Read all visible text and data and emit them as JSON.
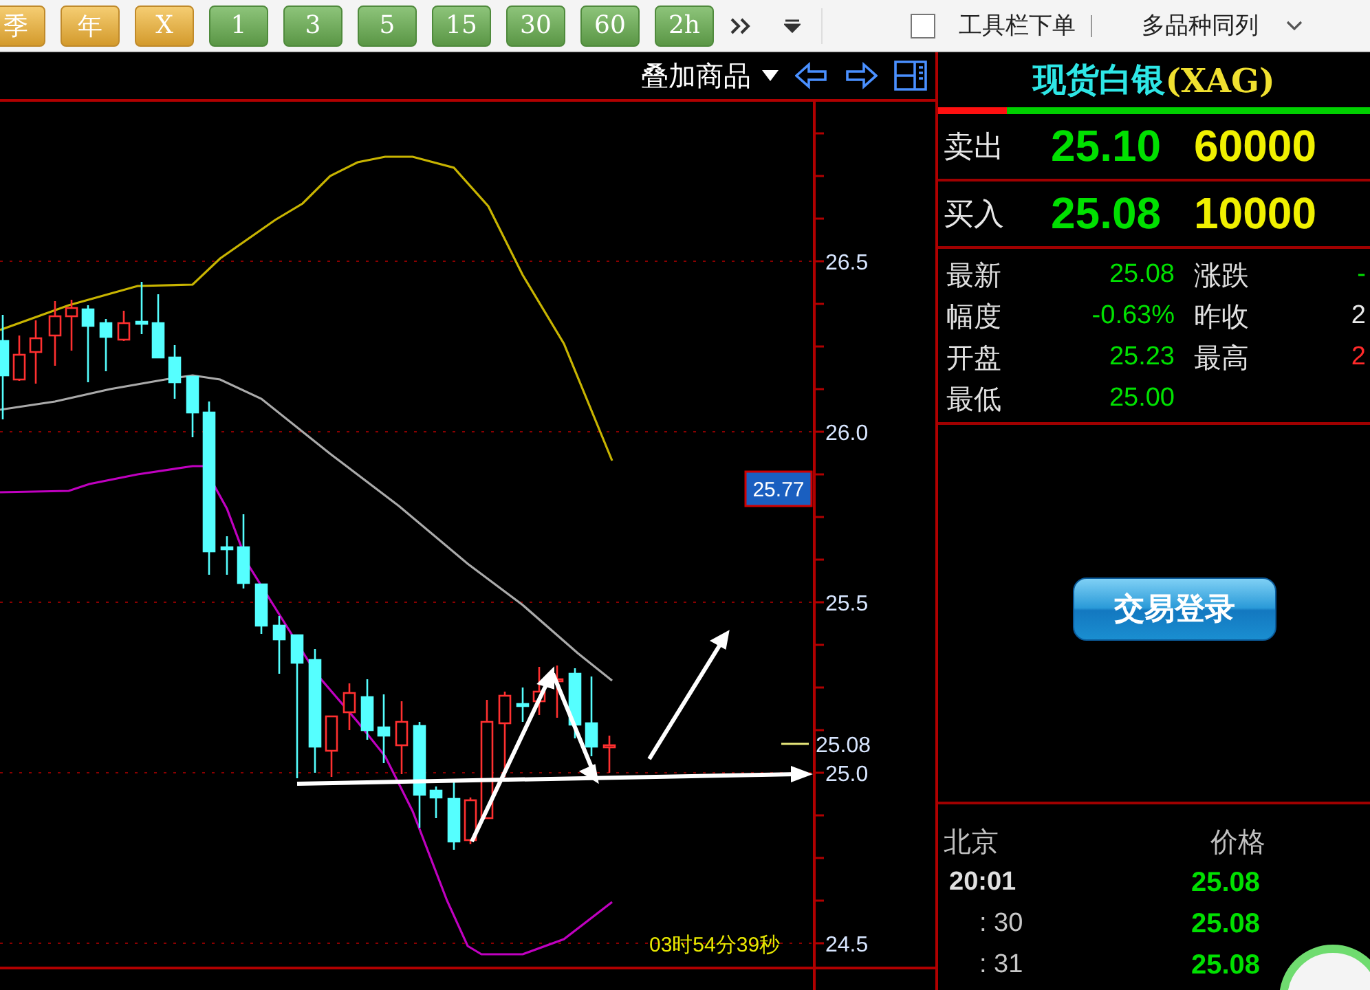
{
  "toolbar": {
    "periods": [
      {
        "label": "季",
        "kind": "long"
      },
      {
        "label": "年",
        "kind": "long"
      },
      {
        "label": "X",
        "kind": "long"
      },
      {
        "label": "1",
        "kind": "short"
      },
      {
        "label": "3",
        "kind": "short"
      },
      {
        "label": "5",
        "kind": "short"
      },
      {
        "label": "15",
        "kind": "short"
      },
      {
        "label": "30",
        "kind": "short"
      },
      {
        "label": "60",
        "kind": "short"
      },
      {
        "label": "2h",
        "kind": "short"
      }
    ],
    "toolbar_order": {
      "label": "工具栏下单",
      "checked": false
    },
    "layout_menu": {
      "label": "多品种同列"
    }
  },
  "chart": {
    "overlay_menu": "叠加商品",
    "price_axis": [
      "26.5",
      "26.0",
      "25.5",
      "25.0",
      "24.5"
    ],
    "last_price": "25.08",
    "cursor_price": "25.77",
    "countdown": "03时54分39秒"
  },
  "quote": {
    "title": "现货白银",
    "symbol": "(XAG)",
    "buy_sell_ratio": {
      "level": 0.16
    },
    "ask": {
      "label": "卖出",
      "price": "25.10",
      "volume": "60000"
    },
    "bid": {
      "label": "买入",
      "price": "25.08",
      "volume": "10000"
    },
    "fields": [
      {
        "label": "最新",
        "value": "25.08",
        "color": "#00e000"
      },
      {
        "label": "涨跌",
        "value": "-",
        "color": "#00e000"
      },
      {
        "label": "幅度",
        "value": "-0.63%",
        "color": "#00e000"
      },
      {
        "label": "昨收",
        "value": "2",
        "color": "#e8e8e8"
      },
      {
        "label": "开盘",
        "value": "25.23",
        "color": "#00e000"
      },
      {
        "label": "最高",
        "value": "2",
        "color": "#ff2a2a"
      },
      {
        "label": "最低",
        "value": "25.00",
        "color": "#00e000"
      }
    ],
    "login_button": "交易登录",
    "ticks": {
      "columns": [
        "北京",
        "价格"
      ],
      "rows": [
        {
          "time": "20:01",
          "price": "25.08",
          "kind": "minute"
        },
        {
          "time": ": 30",
          "price": "25.08",
          "kind": "second"
        },
        {
          "time": ": 31",
          "price": "25.08",
          "kind": "second"
        }
      ]
    }
  }
}
